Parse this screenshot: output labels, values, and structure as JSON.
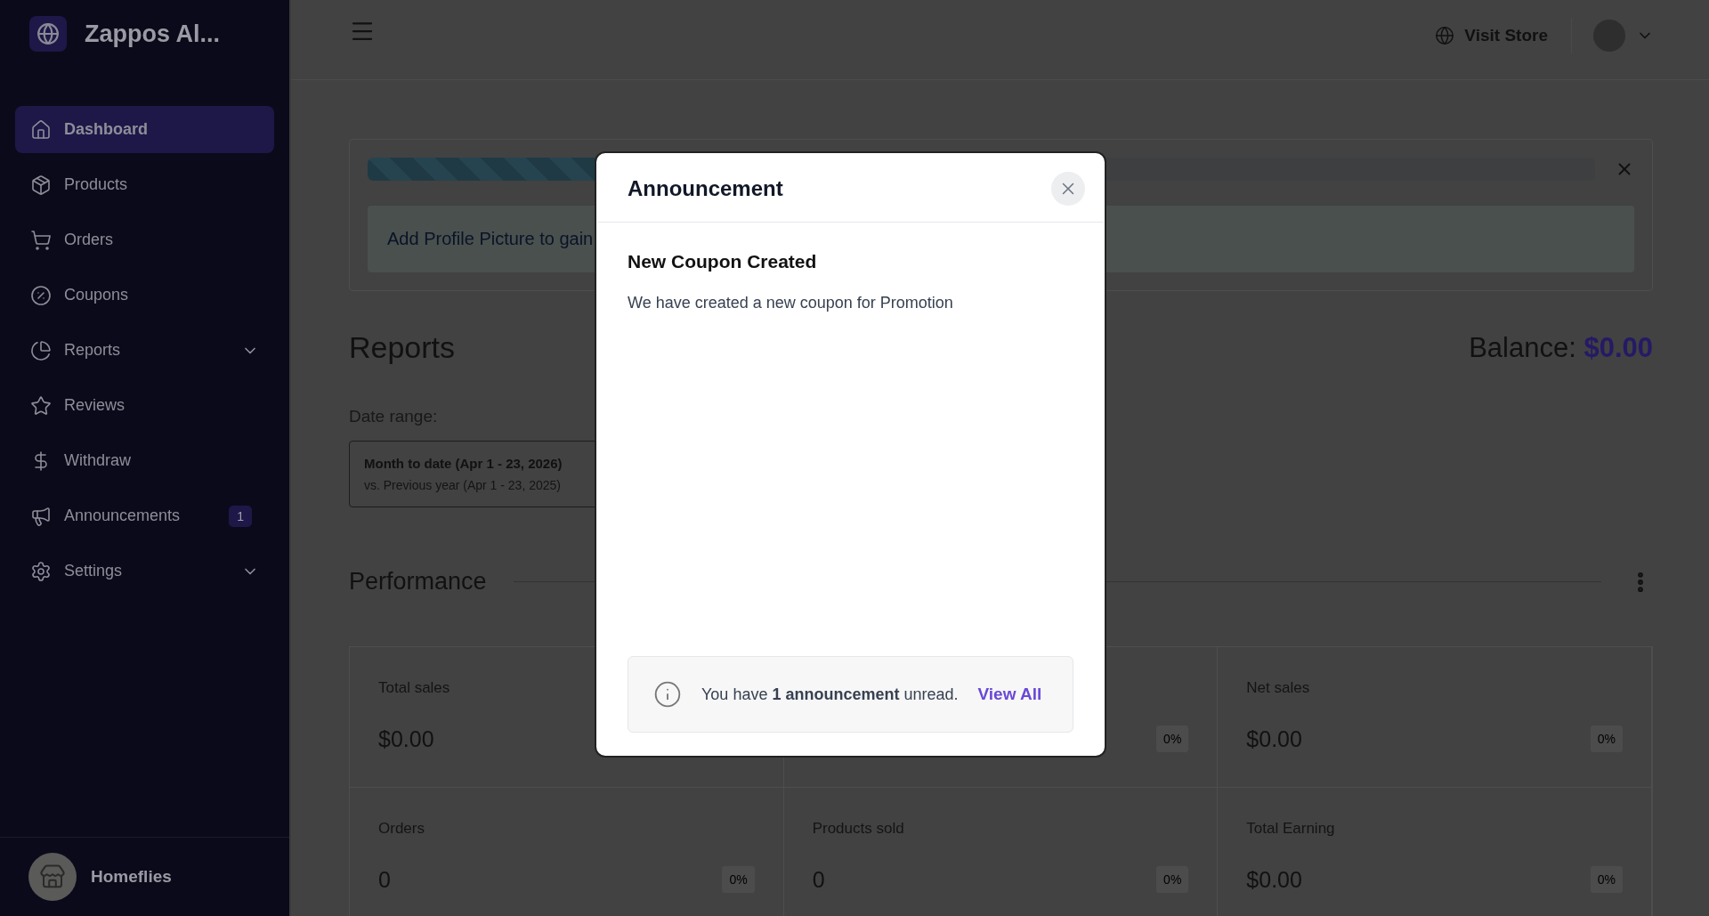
{
  "sidebar": {
    "store_name": "Zappos Al...",
    "items": [
      {
        "label": "Dashboard",
        "selected": true,
        "expandable": false
      },
      {
        "label": "Products",
        "selected": false,
        "expandable": false
      },
      {
        "label": "Orders",
        "selected": false,
        "expandable": false
      },
      {
        "label": "Coupons",
        "selected": false,
        "expandable": false
      },
      {
        "label": "Reports",
        "selected": false,
        "expandable": true
      },
      {
        "label": "Reviews",
        "selected": false,
        "expandable": false
      },
      {
        "label": "Withdraw",
        "selected": false,
        "expandable": false
      },
      {
        "label": "Announcements",
        "selected": false,
        "expandable": false,
        "badge": "1"
      },
      {
        "label": "Settings",
        "selected": false,
        "expandable": true
      }
    ],
    "footer": {
      "name": "Homeflies"
    }
  },
  "header": {
    "visit_store": "Visit Store"
  },
  "setup_card": {
    "progress": {
      "level": 0.45
    },
    "tip": "Add Profile Picture to gain"
  },
  "reports": {
    "title": "Reports",
    "balance_label": "Balance:",
    "balance_value": "$0.00",
    "date_range_label": "Date range:",
    "date_range": {
      "primary": "Month to date (Apr 1 - 23, 2026)",
      "comparison": "vs. Previous year (Apr 1 - 23, 2025)"
    }
  },
  "performance": {
    "title": "Performance",
    "stats": [
      {
        "label": "Total sales",
        "value": "$0.00"
      },
      {
        "change": "0%"
      },
      {
        "label": "Net sales",
        "value": "$0.00",
        "change": "0%"
      },
      {
        "label": "Orders",
        "value": "0",
        "change": "0%"
      },
      {
        "label": "Products sold",
        "value": "0",
        "change": "0%"
      },
      {
        "label": "Total Earning",
        "value": "$0.00",
        "change": "0%"
      }
    ]
  },
  "modal": {
    "title": "Announcement",
    "heading": "New Coupon Created",
    "body": "We have created a new coupon for Promotion",
    "notice": "You have **1 announcement** unread.",
    "link": "View All"
  }
}
